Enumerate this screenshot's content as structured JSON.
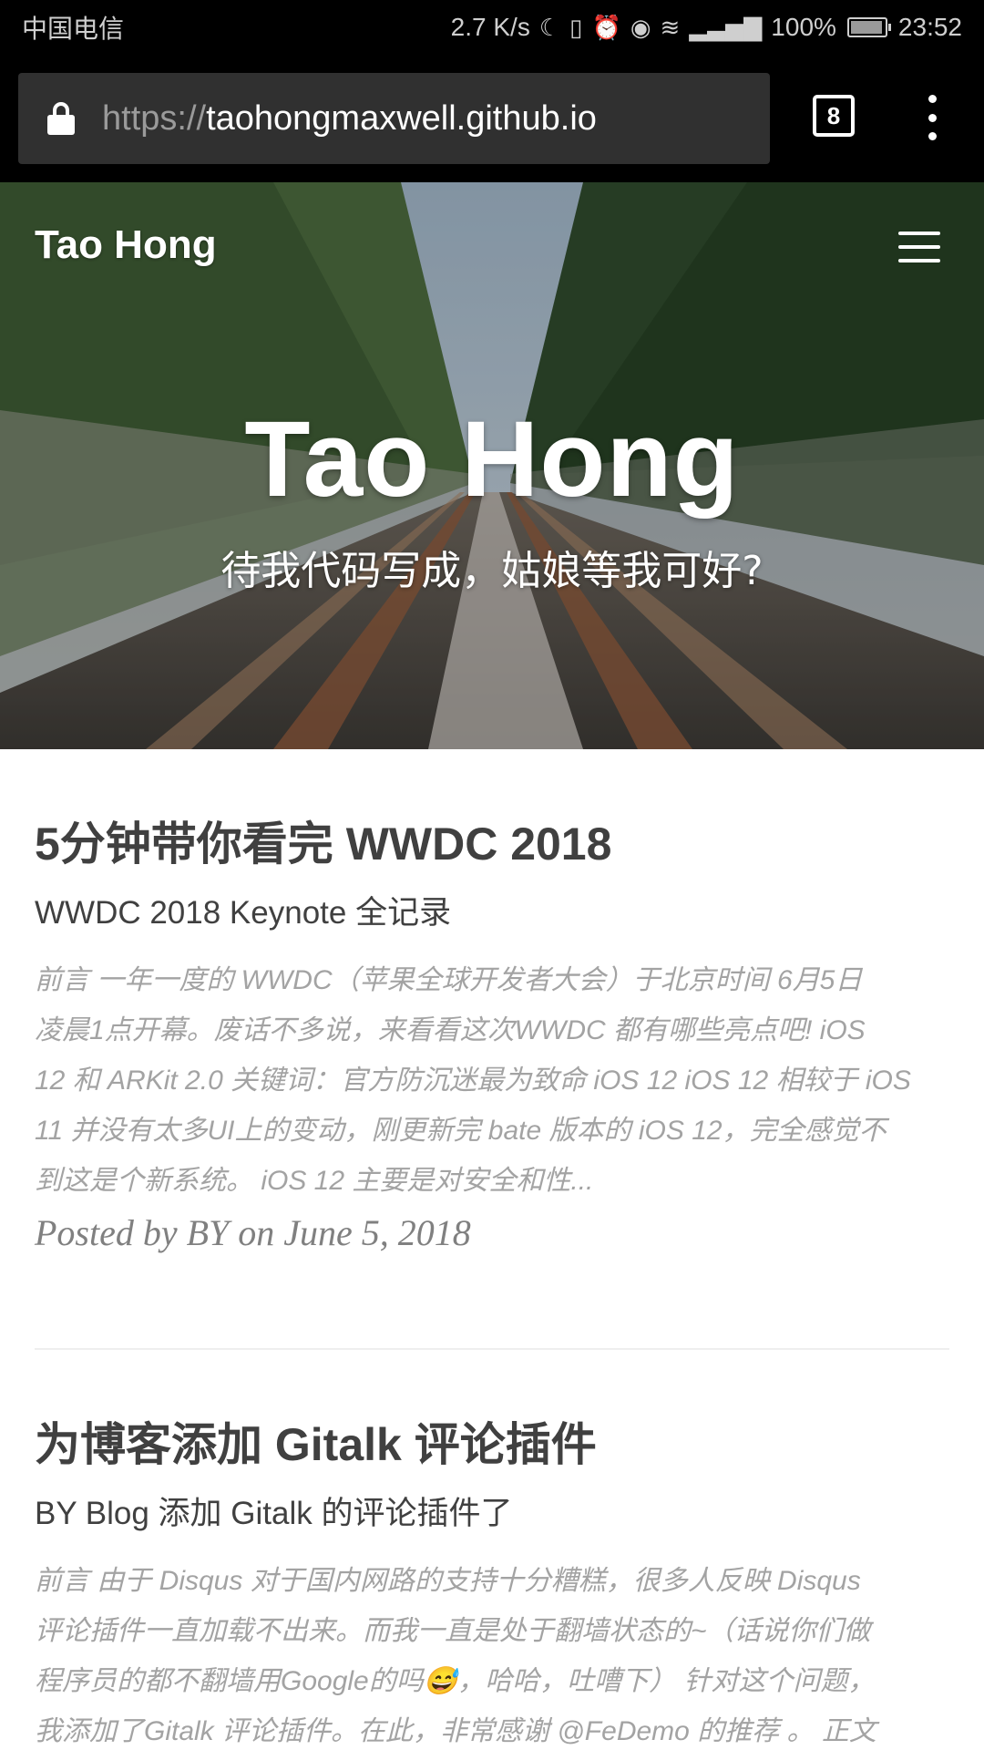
{
  "status_bar": {
    "carrier": "中国电信",
    "net_speed": "2.7 K/s",
    "battery": "100%",
    "time": "23:52",
    "icons": [
      "moon-icon",
      "vibrate-icon",
      "alarm-icon",
      "eye-icon",
      "wifi-icon",
      "signal-icon",
      "battery-icon"
    ]
  },
  "browser": {
    "url_scheme": "https://",
    "url_host": "taohongmaxwell.github.io",
    "tab_count": "8"
  },
  "site": {
    "brand": "Tao Hong",
    "hero_title": "Tao Hong",
    "hero_subtitle": "待我代码写成，姑娘等我可好?"
  },
  "posts": [
    {
      "title": "5分钟带你看完 WWDC 2018",
      "subtitle": "WWDC 2018 Keynote 全记录",
      "excerpt_lines": [
        "前言 一年一度的 WWDC（苹果全球开发者大会）于北京时间 6月5日",
        "凌晨1点开幕。废话不多说，来看看这次WWDC 都有哪些亮点吧! iOS",
        "12 和 ARKit 2.0 关键词：官方防沉迷最为致命 iOS 12 iOS 12 相较于 iOS",
        "11 并没有太多UI上的变动，刚更新完 bate 版本的 iOS 12，完全感觉不",
        "到这是个新系统。 iOS 12 主要是对安全和性..."
      ],
      "meta": "Posted by BY on June 5, 2018"
    },
    {
      "title": "为博客添加 Gitalk 评论插件",
      "subtitle": "BY Blog 添加 Gitalk 的评论插件了",
      "excerpt_lines": [
        "前言 由于 Disqus 对于国内网路的支持十分糟糕，很多人反映 Disqus",
        "评论插件一直加载不出来。而我一直是处于翻墙状态的~（话说你们做",
        "程序员的都不翻墙用Google的吗😅，哈哈，吐嘈下） 针对这个问题，",
        "我添加了Gitalk 评论插件。在此，非常感谢 @FeDemo 的推荐 。 正文"
      ]
    }
  ]
}
